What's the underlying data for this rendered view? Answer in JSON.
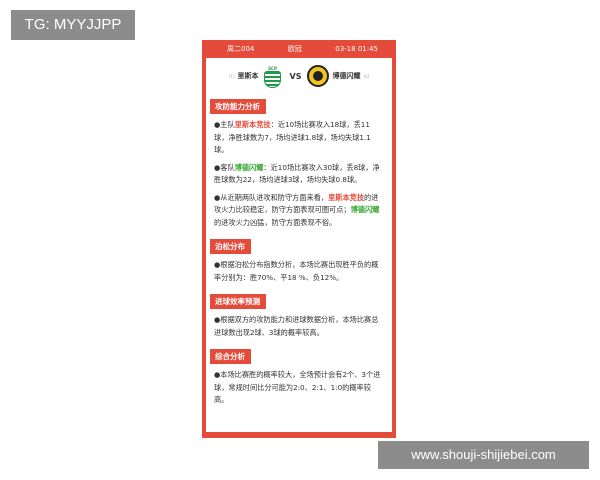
{
  "overlay": {
    "tg_text": "TG: MYYJJPP",
    "site_text": "www.shouji-shijiebei.com"
  },
  "header": {
    "match_id": "周二004",
    "league": "欧冠",
    "datetime": "03-18 01:45"
  },
  "teams": {
    "home_tag": "[1]",
    "home_name": "里斯本",
    "vs": "VS",
    "away_name": "博德闪耀",
    "away_tag": "[6]",
    "home_logo_text": "SCP"
  },
  "sections": {
    "attack_defense": {
      "title": "攻防能力分析",
      "home": {
        "prefix": "●主队",
        "team": "里斯本竞技",
        "text": "：近10场比赛攻入18球，丢11球，净胜球数为7，场均进球1.8球，场均失球1.1球。"
      },
      "away": {
        "prefix": "●客队",
        "team": "博德闪耀",
        "text": "：近10场比赛攻入30球，丢8球，净胜球数为22，场均进球3球，场均失球0.8球。"
      },
      "compare": {
        "p1": "●从近期两队进攻和防守方面来看，",
        "team1": "里斯本竞技",
        "p2": "的进攻火力比较稳定，防守方面表现可圈可点；",
        "team2": "博德闪耀",
        "p3": "的进攻火力凶猛，防守方面表现不俗。"
      }
    },
    "poisson": {
      "title": "泊松分布",
      "text": "●根据泊松分布指数分析，本场比赛出现胜平负的概率分别为：胜70%、平18 %、负12%。"
    },
    "goal_efficiency": {
      "title": "进球效率预测",
      "text": "●根据双方的攻防能力和进球数据分析，本场比赛总进球数出现2球、3球的概率较高。"
    },
    "summary": {
      "title": "综合分析",
      "text": "●本场比赛胜的概率较大，全场预计会有2个、3个进球，常规时间比分可能为2:0、2:1、1:0的概率较高。"
    }
  }
}
